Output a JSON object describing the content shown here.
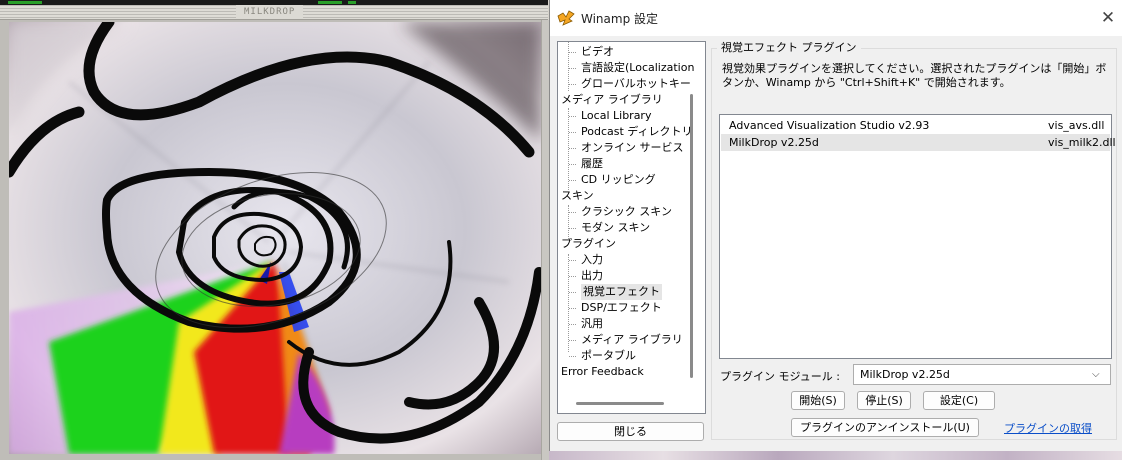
{
  "milkdrop_window": {
    "title": "MILKDROP"
  },
  "dialog": {
    "title": "Winamp 設定",
    "close_symbol": "✕",
    "tree": [
      {
        "label": "ビデオ",
        "level": 1
      },
      {
        "label": "言語設定(Localization",
        "level": 1
      },
      {
        "label": "グローバルホットキー",
        "level": 1
      },
      {
        "label": "メディア ライブラリ",
        "level": 0
      },
      {
        "label": "Local Library",
        "level": 1
      },
      {
        "label": "Podcast ディレクトリ",
        "level": 1
      },
      {
        "label": "オンライン サービス",
        "level": 1
      },
      {
        "label": "履歴",
        "level": 1
      },
      {
        "label": "CD リッピング",
        "level": 1
      },
      {
        "label": "スキン",
        "level": 0
      },
      {
        "label": "クラシック スキン",
        "level": 1
      },
      {
        "label": "モダン スキン",
        "level": 1
      },
      {
        "label": "プラグイン",
        "level": 0
      },
      {
        "label": "入力",
        "level": 1
      },
      {
        "label": "出力",
        "level": 1
      },
      {
        "label": "視覚エフェクト",
        "level": 1,
        "selected": true
      },
      {
        "label": "DSP/エフェクト",
        "level": 1
      },
      {
        "label": "汎用",
        "level": 1
      },
      {
        "label": "メディア ライブラリ",
        "level": 1
      },
      {
        "label": "ポータブル",
        "level": 1
      },
      {
        "label": "Error Feedback",
        "level": 0
      }
    ],
    "close_button": "閉じる",
    "panel": {
      "group_title": "視覚エフェクト プラグイン",
      "description": "視覚効果プラグインを選択してください。選択されたプラグインは「開始」ボタンか、Winamp から \"Ctrl+Shift+K\" で開始されます。",
      "plugins": [
        {
          "name": "Advanced Visualization Studio v2.93",
          "file": "vis_avs.dll",
          "selected": false
        },
        {
          "name": "MilkDrop v2.25d",
          "file": "vis_milk2.dll",
          "selected": true
        }
      ],
      "module_label": "プラグイン モジュール :",
      "module_value": "MilkDrop v2.25d",
      "start_button": "開始(S)",
      "stop_button": "停止(S)",
      "config_button": "設定(C)",
      "uninstall_button": "プラグインのアンインストール(U)",
      "get_plugins_link": "プラグインの取得"
    }
  },
  "colors": {
    "accent_link": "#0a4ec8",
    "selection": "#e5e5e5",
    "dialog_bg": "#f0f0f0"
  }
}
